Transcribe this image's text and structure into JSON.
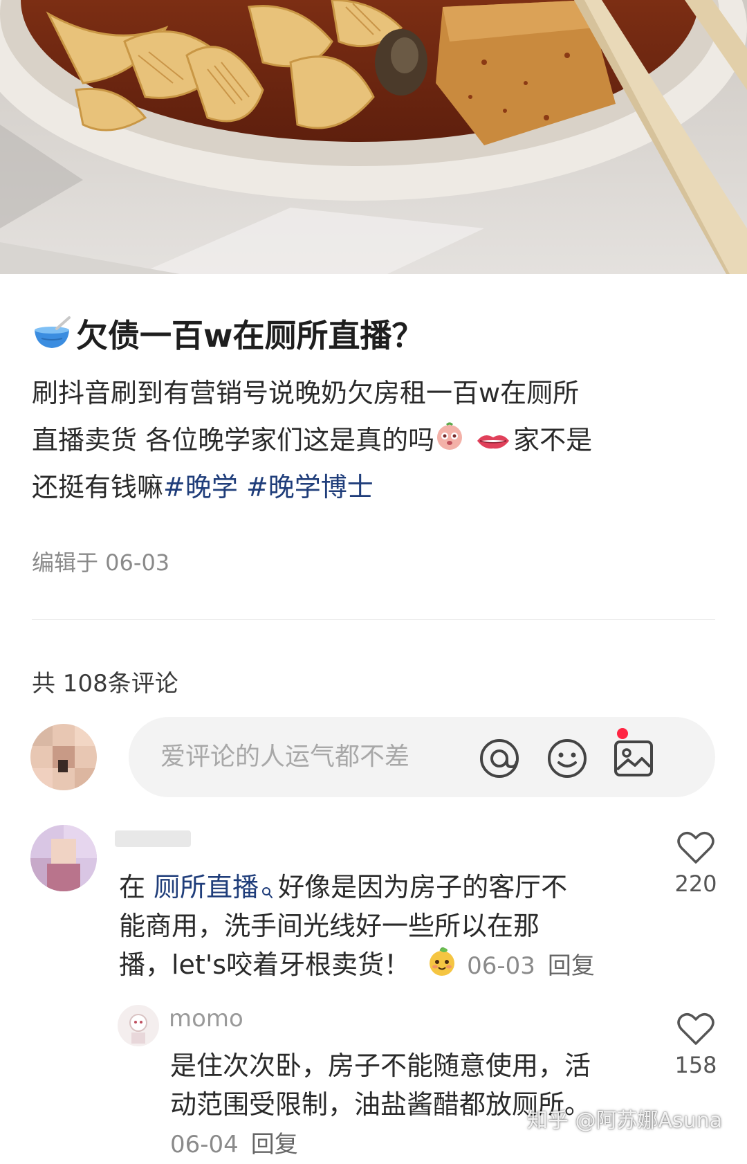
{
  "post": {
    "title": "欠债一百w在厕所直播？",
    "title_icon": "bowl-emoji",
    "body_line1": "刷抖音刷到有营销号说晚奶欠房租一百w在厕所",
    "body_line2a": "直播卖货 各位晚学家们这是真的吗",
    "body_line2b": "家不是",
    "body_line3": "还挺有钱嘛",
    "hashtags": [
      "#晚学",
      "#晚学博士"
    ],
    "edited": "编辑于 06-03"
  },
  "comments_header": {
    "count_label": "共 108条评论"
  },
  "comment_input": {
    "placeholder": "爱评论的人运气都不差",
    "icons": [
      "at-icon",
      "emoji-icon",
      "image-icon"
    ],
    "notification_color": "#ff2442"
  },
  "comments": [
    {
      "prefix": "在",
      "link": "厕所直播",
      "line1_rest": "好像是因为房子的客厅不",
      "line2": "能商用，洗手间光线好一些所以在那",
      "line3": "播，let's咬着牙根卖货！",
      "date": "06-03",
      "reply_label": "回复",
      "likes": "220"
    },
    {
      "username": "momo",
      "line1": "是住次次卧，房子不能随意使用，活",
      "line2": "动范围受限制，油盐酱醋都放厕所。",
      "date": "06-04",
      "reply_label": "回复",
      "likes": "158"
    }
  ],
  "watermark": "知乎 @阿苏娜Asuna",
  "colors": {
    "accent_link": "#1f3d7a",
    "muted": "#8a8a8a",
    "badge_red": "#ff2442"
  }
}
